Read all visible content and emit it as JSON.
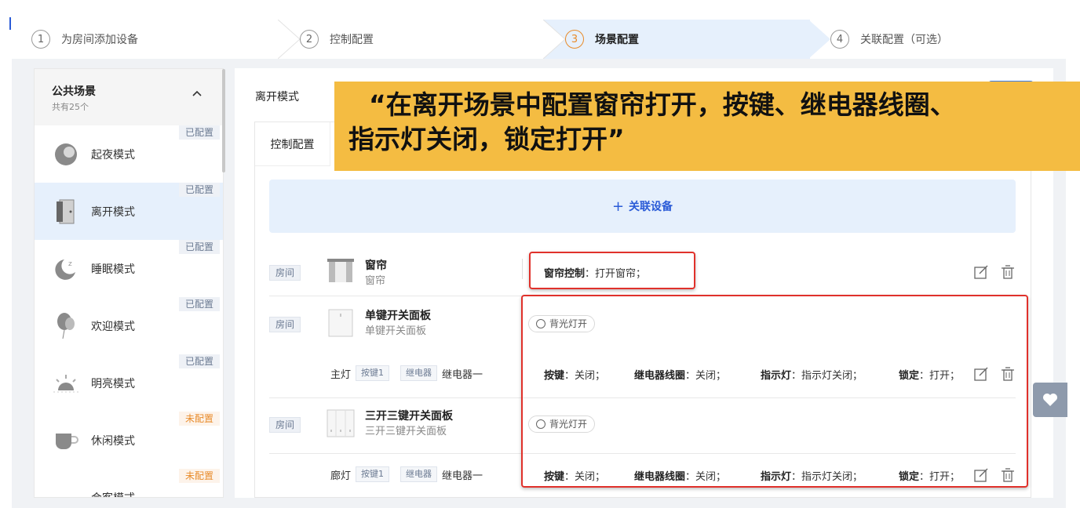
{
  "steps": [
    {
      "num": "1",
      "label": "为房间添加设备"
    },
    {
      "num": "2",
      "label": "控制配置"
    },
    {
      "num": "3",
      "label": "场景配置"
    },
    {
      "num": "4",
      "label": "关联配置（可选）"
    }
  ],
  "sidebar": {
    "title": "公共场景",
    "subtitle": "共有25个",
    "toggle": "^",
    "scenes": [
      {
        "name": "起夜模式",
        "status": "已配置"
      },
      {
        "name": "离开模式",
        "status": "已配置"
      },
      {
        "name": "睡眠模式",
        "status": "已配置"
      },
      {
        "name": "欢迎模式",
        "status": "已配置"
      },
      {
        "name": "明亮模式",
        "status": "已配置"
      },
      {
        "name": "休闲模式",
        "status": "未配置"
      },
      {
        "name": "会客模式",
        "status": "未配置"
      }
    ]
  },
  "main": {
    "title": "离开模式",
    "tab": "控制配置",
    "add_device": "关联设备",
    "add_icon": "+"
  },
  "devices": {
    "curtain": {
      "room": "房间",
      "name": "窗帘",
      "sub": "窗帘",
      "action_key": "窗帘控制",
      "action_val": "打开窗帘；"
    },
    "panel1": {
      "room": "房间",
      "name": "单键开关面板",
      "sub": "单键开关面板",
      "pill": "背光灯开"
    },
    "panel1_row": {
      "light": "主灯",
      "key_tag": "按键1",
      "relay_tag": "继电器",
      "relay": "继电器一",
      "a1k": "按键",
      "a1v": "关闭；",
      "a2k": "继电器线圈",
      "a2v": "关闭；",
      "a3k": "指示灯",
      "a3v": "指示灯关闭；",
      "a4k": "锁定",
      "a4v": "打开；"
    },
    "panel3": {
      "room": "房间",
      "name": "三开三键开关面板",
      "sub": "三开三键开关面板",
      "pill": "背光灯开"
    },
    "panel3_row": {
      "light": "廊灯",
      "key_tag": "按键1",
      "relay_tag": "继电器",
      "relay": "继电器一",
      "a1k": "按键",
      "a1v": "关闭；",
      "a2k": "继电器线圈",
      "a2v": "关闭；",
      "a3k": "指示灯",
      "a3v": "指示灯关闭；",
      "a4k": "锁定",
      "a4v": "打开；"
    }
  },
  "annotation": {
    "line1": "“在离开场景中配置窗帘打开，按键、继电器线圈、",
    "line2": "指示灯关闭，锁定打开”"
  },
  "colors": {
    "accent": "#2a5bd7",
    "highlight": "#e0312b",
    "callout": "#f4bc42",
    "warn": "#e88b2a"
  }
}
